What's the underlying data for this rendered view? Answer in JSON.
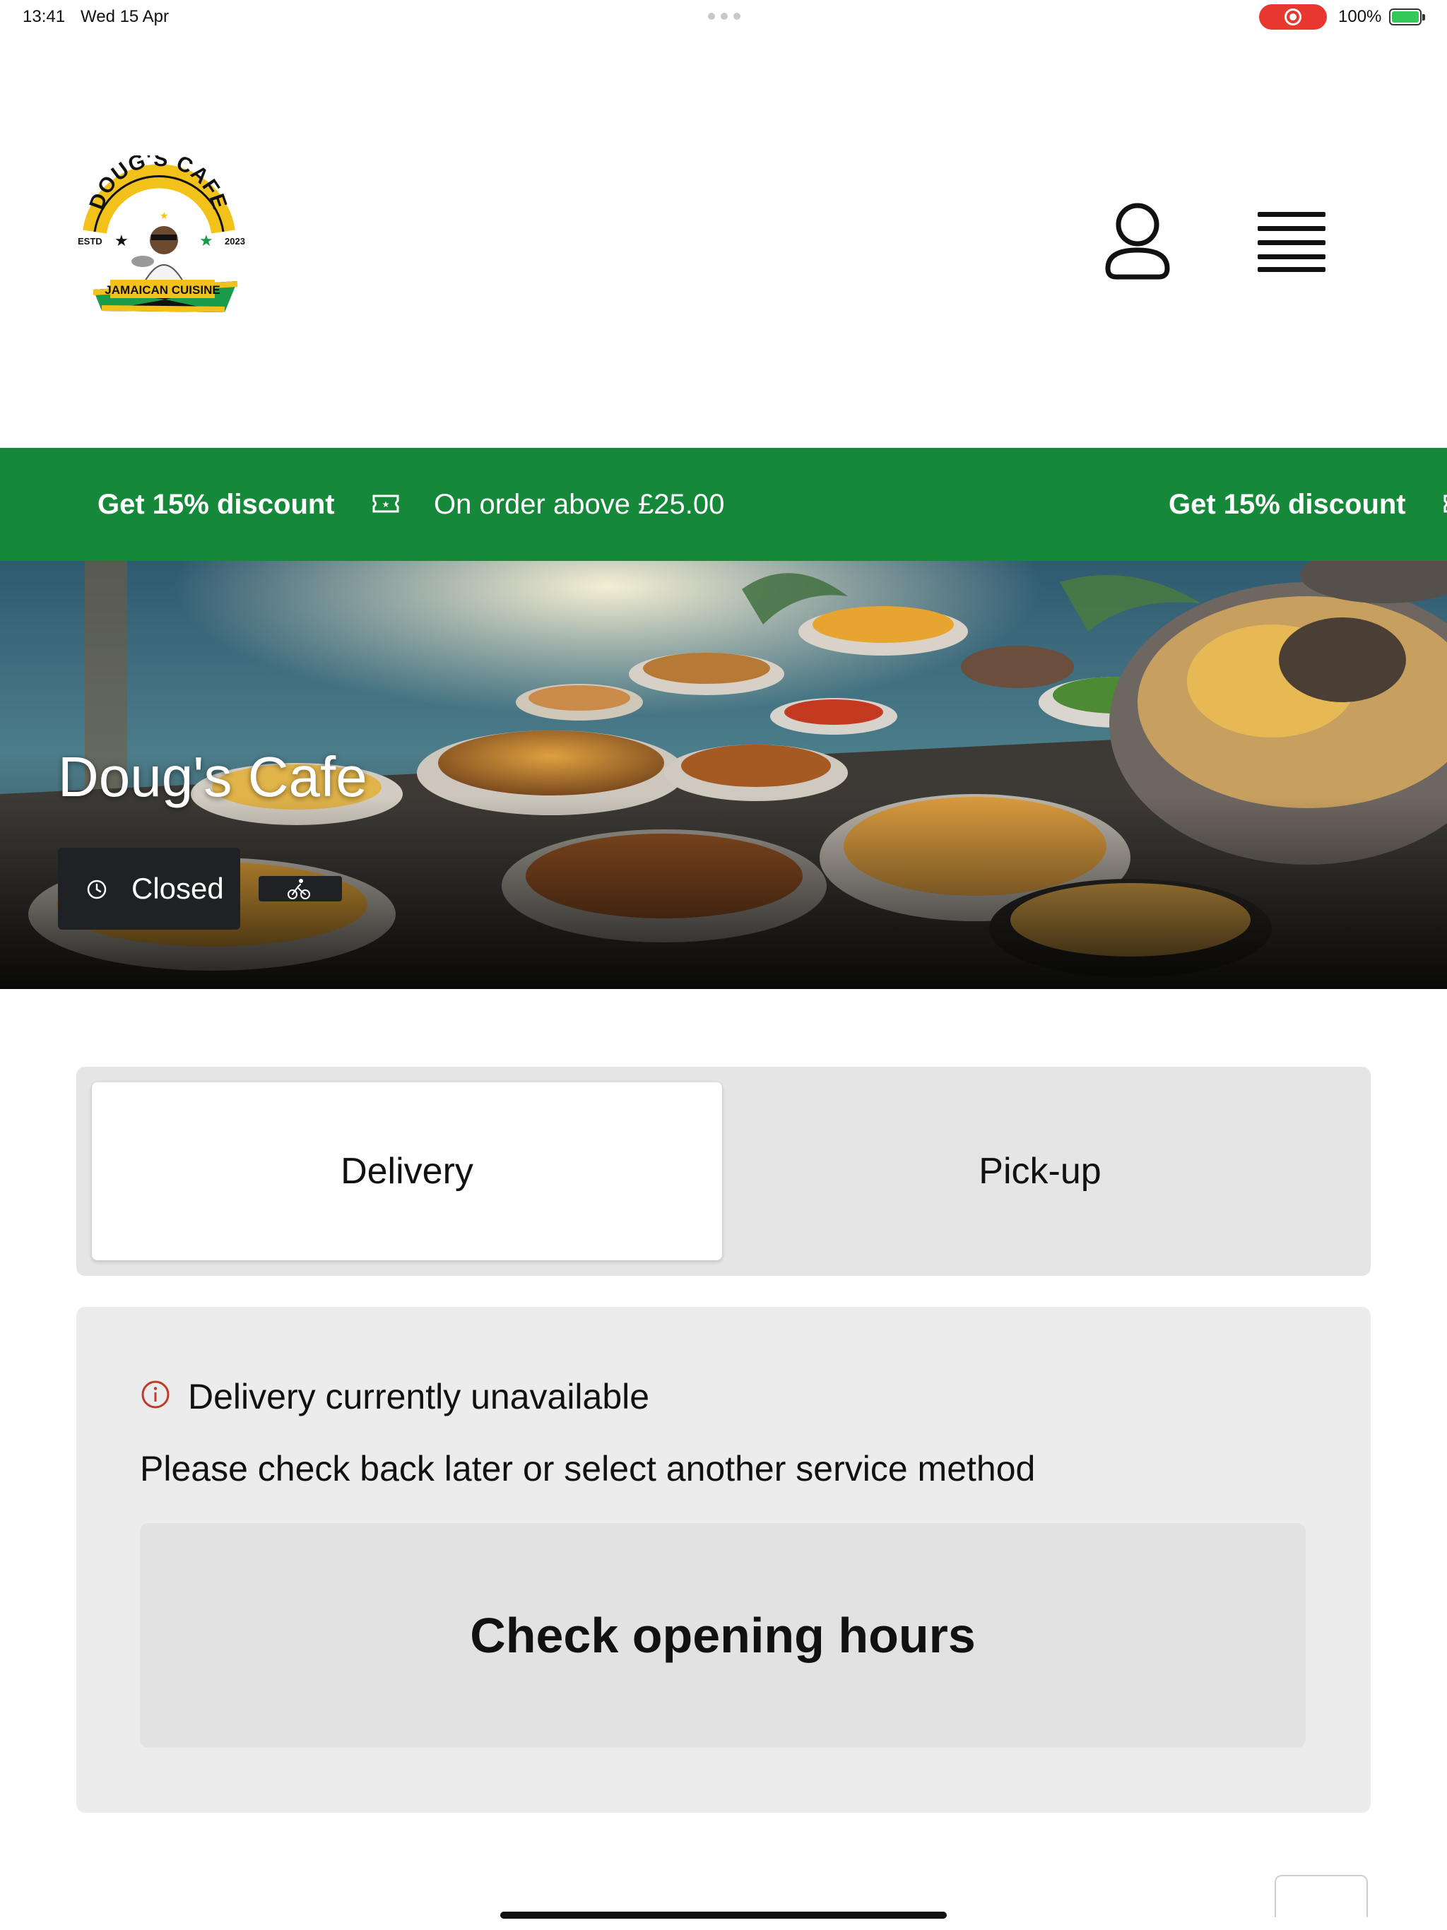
{
  "status_bar": {
    "time": "13:41",
    "date": "Wed 15 Apr",
    "battery": "100%"
  },
  "logo": {
    "text_top": "DOUG'S CAFE",
    "estd": "ESTD",
    "year": "2023",
    "ribbon": "JAMAICAN CUISINE"
  },
  "promo": {
    "title": "Get 15% discount",
    "subtitle": "On order above £25.00",
    "title_repeat": "Get 15% discount",
    "background": "#15883a"
  },
  "hero": {
    "restaurant_name": "Doug's Cafe",
    "status": "Closed"
  },
  "service_tabs": [
    {
      "label": "Delivery",
      "active": true
    },
    {
      "label": "Pick-up",
      "active": false
    }
  ],
  "notice": {
    "title": "Delivery currently unavailable",
    "message": "Please check back later or select another service method",
    "button": "Check opening hours",
    "icon_color": "#c0392b"
  },
  "icons": [
    "clock-icon",
    "bike-icon",
    "ticket-icon",
    "user-icon",
    "menu-icon",
    "info-icon"
  ]
}
